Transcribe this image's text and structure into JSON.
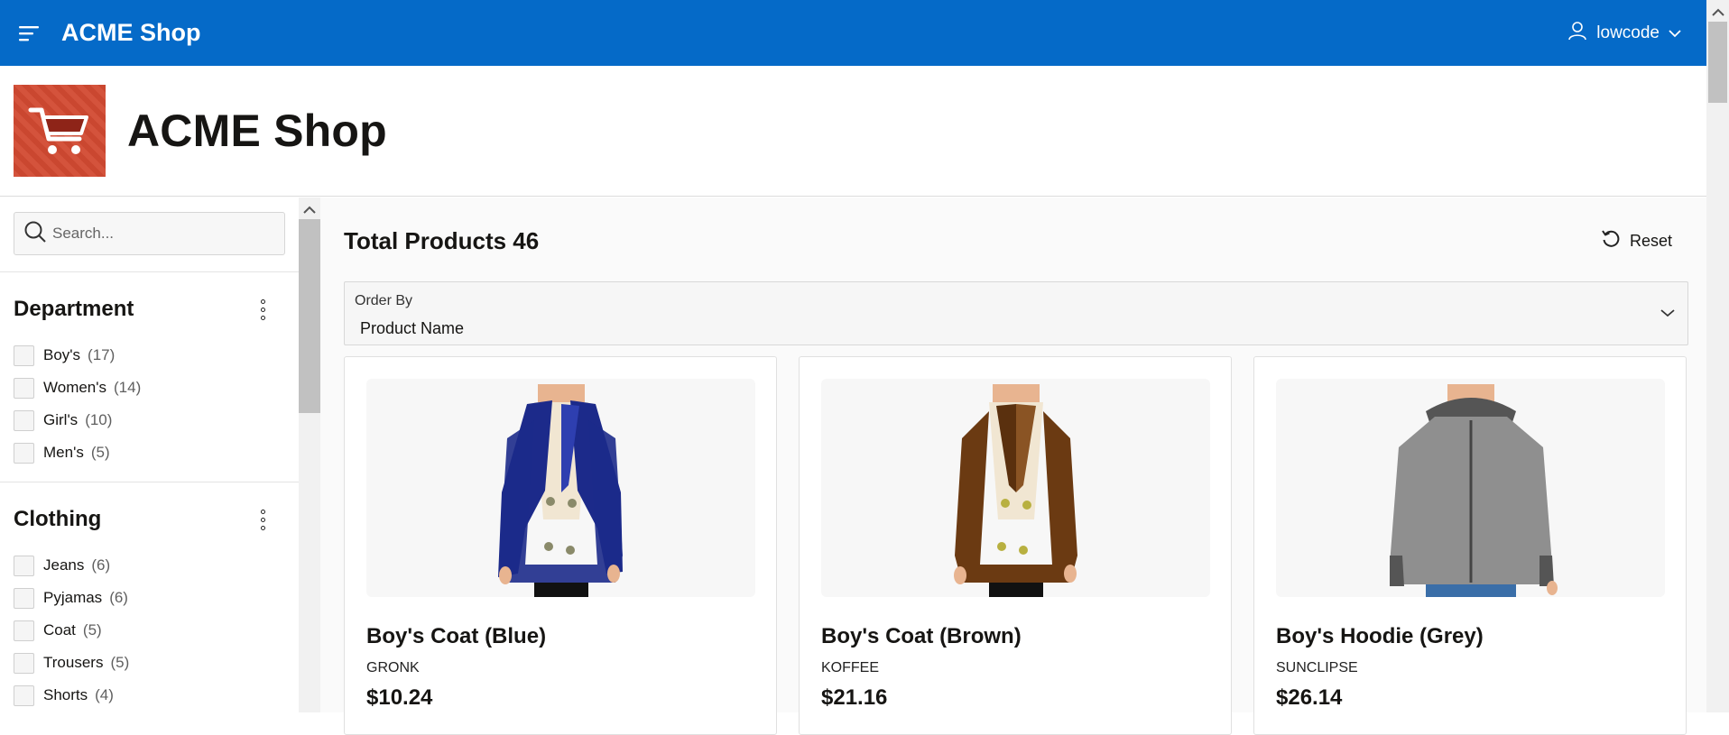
{
  "topbar": {
    "app_name": "ACME Shop",
    "username": "lowcode",
    "menu_icon": "hamburger-icon",
    "user_icon": "user-icon",
    "caret_icon": "chevron-down-icon",
    "background": "#056ac8"
  },
  "header": {
    "title": "ACME Shop",
    "logo_icon": "shopping-cart-icon",
    "logo_color": "#d24a32"
  },
  "search": {
    "placeholder": "Search..."
  },
  "facets": [
    {
      "title": "Department",
      "items": [
        {
          "label": "Boy's",
          "count": "(17)"
        },
        {
          "label": "Women's",
          "count": "(14)"
        },
        {
          "label": "Girl's",
          "count": "(10)"
        },
        {
          "label": "Men's",
          "count": "(5)"
        }
      ]
    },
    {
      "title": "Clothing",
      "items": [
        {
          "label": "Jeans",
          "count": "(6)"
        },
        {
          "label": "Pyjamas",
          "count": "(6)"
        },
        {
          "label": "Coat",
          "count": "(5)"
        },
        {
          "label": "Trousers",
          "count": "(5)"
        },
        {
          "label": "Shorts",
          "count": "(4)"
        }
      ]
    }
  ],
  "results": {
    "total_label": "Total Products 46",
    "reset_label": "Reset",
    "order_by_label": "Order By",
    "order_by_value": "Product Name"
  },
  "products": [
    {
      "name": "Boy's Coat (Blue)",
      "brand": "GRONK",
      "price": "$10.24",
      "color": "#1c2a8a",
      "kind": "coat"
    },
    {
      "name": "Boy's Coat (Brown)",
      "brand": "KOFFEE",
      "price": "$21.16",
      "color": "#6b3a12",
      "kind": "coat"
    },
    {
      "name": "Boy's Hoodie (Grey)",
      "brand": "SUNCLIPSE",
      "price": "$26.14",
      "color": "#8f8f8f",
      "kind": "hoodie"
    }
  ]
}
